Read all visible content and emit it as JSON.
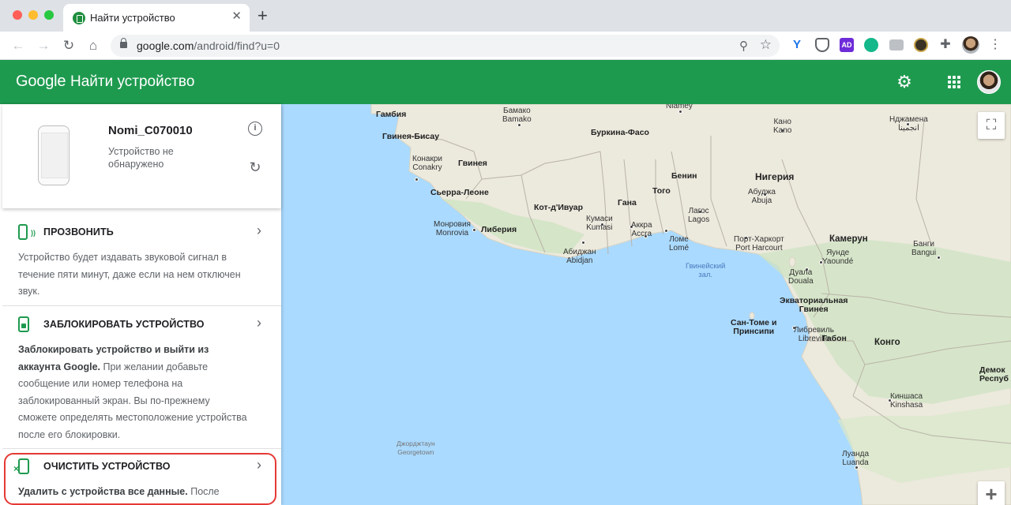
{
  "browser": {
    "tab_title": "Найти устройство",
    "url_domain": "google.com",
    "url_path": "/android/find?u=0"
  },
  "appbar": {
    "logo": "Google",
    "title": "Найти устройство"
  },
  "device": {
    "name": "Nomi_C070010",
    "status": "Устройство не обнаружено"
  },
  "actions": [
    {
      "label": "ПРОЗВОНИТЬ",
      "desc": "Устройство будет издавать звуковой сигнал в течение пяти минут, даже если на нем отключен звук."
    },
    {
      "label": "ЗАБЛОКИРОВАТЬ УСТРОЙСТВО",
      "desc_bold": "Заблокировать устройство и выйти из аккаунта Google.",
      "desc": " При желании добавьте сообщение или номер телефона на заблокированный экран. Вы по-прежнему сможете определять местоположение устройства после его блокировки."
    },
    {
      "label": "ОЧИСТИТЬ УСТРОЙСТВО",
      "desc_bold": "Удалить с устройства все данные.",
      "desc": " После"
    }
  ],
  "map": {
    "labels": [
      {
        "text": "Гамбия",
        "type": "country"
      },
      {
        "text": "Гвинея-Бисау",
        "type": "country"
      },
      {
        "text": "Конакри\nConakry",
        "type": "city"
      },
      {
        "text": "Гвинея",
        "type": "country"
      },
      {
        "text": "Сьерра-Леоне",
        "type": "country"
      },
      {
        "text": "Монровия\nMonrovia",
        "type": "city"
      },
      {
        "text": "Либерия",
        "type": "country"
      },
      {
        "text": "Бамако\nBamako",
        "type": "city"
      },
      {
        "text": "Буркина-Фасо",
        "type": "country"
      },
      {
        "text": "Niamey",
        "type": "city"
      },
      {
        "text": "Кот-д'Ивуар",
        "type": "country"
      },
      {
        "text": "Гана",
        "type": "country"
      },
      {
        "text": "Того",
        "type": "country"
      },
      {
        "text": "Бенин",
        "type": "country"
      },
      {
        "text": "Кумаси\nKumasi",
        "type": "city"
      },
      {
        "text": "Аккра\nAccra",
        "type": "city"
      },
      {
        "text": "Абиджан\nAbidjan",
        "type": "city"
      },
      {
        "text": "Ломе\nLomé",
        "type": "city"
      },
      {
        "text": "Лагос\nLagos",
        "type": "city"
      },
      {
        "text": "Нигерия",
        "type": "country"
      },
      {
        "text": "Абуджа\nAbuja",
        "type": "city"
      },
      {
        "text": "Кано\nKano",
        "type": "city"
      },
      {
        "text": "Нджамена\nانجمينا",
        "type": "city"
      },
      {
        "text": "Гвинейский\nзал.",
        "type": "sea"
      },
      {
        "text": "Порт-Харкорт\nPort Harcourt",
        "type": "city"
      },
      {
        "text": "Камерун",
        "type": "country"
      },
      {
        "text": "Яунде\nYaoundé",
        "type": "city"
      },
      {
        "text": "Дуала\nDouala",
        "type": "city"
      },
      {
        "text": "Банги\nBangui",
        "type": "city"
      },
      {
        "text": "Экваториальная\nГвинея",
        "type": "country"
      },
      {
        "text": "Сан-Томе и\nПринсипи",
        "type": "country"
      },
      {
        "text": "Либревиль\nLibreville",
        "type": "city"
      },
      {
        "text": "Габон",
        "type": "country"
      },
      {
        "text": "Конго",
        "type": "country"
      },
      {
        "text": "Киншаса\nKinshasa",
        "type": "city"
      },
      {
        "text": "Демок\nРеспуб",
        "type": "country"
      },
      {
        "text": "Луанда\nLuanda",
        "type": "city"
      },
      {
        "text": "Джорджтаун\nGeorgetown",
        "type": "sea"
      }
    ]
  },
  "colors": {
    "appbar": "#1e9a4f",
    "highlight": "#e53935",
    "water": "#aadaff",
    "land": "#ece9dd"
  }
}
